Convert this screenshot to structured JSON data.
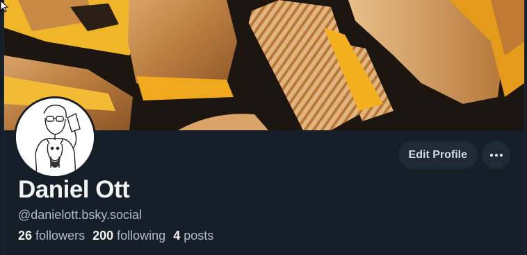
{
  "profile": {
    "display_name": "Daniel Ott",
    "handle": "@danielott.bsky.social",
    "stats": {
      "followers_count": "26",
      "followers_label": "followers",
      "following_count": "200",
      "following_label": "following",
      "posts_count": "4",
      "posts_label": "posts"
    }
  },
  "actions": {
    "edit_profile_label": "Edit Profile",
    "more_icon": "ellipsis-icon"
  },
  "banner": {
    "subject": "grilled cheese sandwiches"
  },
  "colors": {
    "background": "#161e27",
    "button_bg": "#1e2936",
    "text_primary": "#f1f3f5",
    "text_secondary": "#aebbc9"
  }
}
